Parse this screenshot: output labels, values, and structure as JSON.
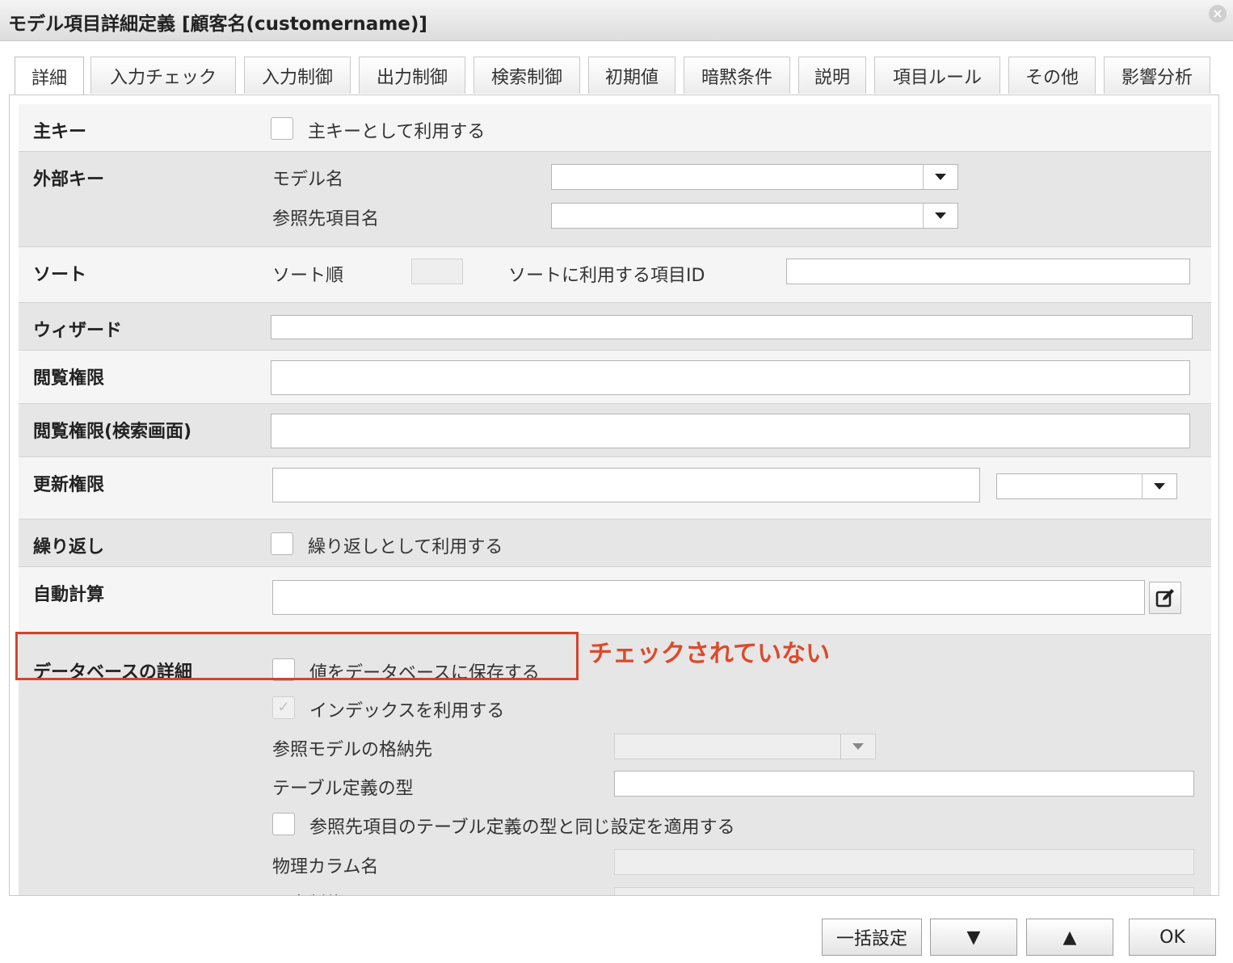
{
  "window": {
    "title": "モデル項目詳細定義 [顧客名(customername)]"
  },
  "tabs": [
    {
      "label": "詳細",
      "active": true
    },
    {
      "label": "入力チェック"
    },
    {
      "label": "入力制御"
    },
    {
      "label": "出力制御"
    },
    {
      "label": "検索制御"
    },
    {
      "label": "初期値"
    },
    {
      "label": "暗黙条件"
    },
    {
      "label": "説明"
    },
    {
      "label": "項目ルール"
    },
    {
      "label": "その他"
    },
    {
      "label": "影響分析"
    }
  ],
  "form": {
    "primary_key": {
      "label": "主キー",
      "checkbox_label": "主キーとして利用する"
    },
    "foreign_key": {
      "label": "外部キー",
      "model_name": "モデル名",
      "ref_item_name": "参照先項目名"
    },
    "sort": {
      "label": "ソート",
      "order_label": "ソート順",
      "item_id_label": "ソートに利用する項目ID"
    },
    "wizard": {
      "label": "ウィザード"
    },
    "view_permission": {
      "label": "閲覧権限"
    },
    "view_permission_search": {
      "label": "閲覧権限(検索画面)"
    },
    "update_permission": {
      "label": "更新権限"
    },
    "repeat": {
      "label": "繰り返し",
      "checkbox_label": "繰り返しとして利用する"
    },
    "auto_calc": {
      "label": "自動計算"
    },
    "db_detail": {
      "label": "データベースの詳細",
      "save_label": "値をデータベースに保存する",
      "index_label": "インデックスを利用する",
      "ref_model_storage": "参照モデルの格納先",
      "table_def_type": "テーブル定義の型",
      "same_setting_label": "参照先項目のテーブル定義の型と同じ設定を適用する",
      "physical_column": "物理カラム名",
      "unique_check": "一意制約をチェックする"
    }
  },
  "annotation": {
    "text": "チェックされていない",
    "color": "#dc4a2c"
  },
  "footer": {
    "bulk": "一括設定",
    "down": "▼",
    "up": "▲",
    "ok": "OK"
  }
}
